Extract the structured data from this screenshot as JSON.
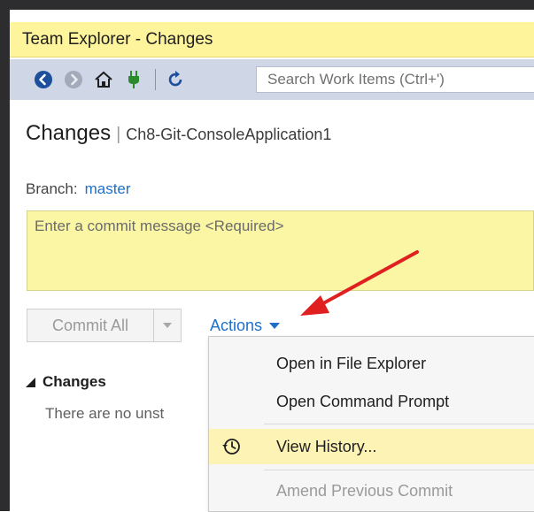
{
  "window": {
    "title": "Team Explorer - Changes"
  },
  "toolbar": {
    "search_placeholder": "Search Work Items (Ctrl+')",
    "icons": [
      "back-icon",
      "forward-icon",
      "home-icon",
      "connect-icon",
      "refresh-icon"
    ]
  },
  "header": {
    "title": "Changes",
    "separator": "|",
    "repository": "Ch8-Git-ConsoleApplication1"
  },
  "branch": {
    "label": "Branch:",
    "name": "master"
  },
  "commit": {
    "message_placeholder": "Enter a commit message <Required>",
    "commit_all_label": "Commit All"
  },
  "actions": {
    "label": "Actions"
  },
  "changes_section": {
    "title": "Changes",
    "empty_text": "There are no unst"
  },
  "menu": {
    "items": [
      {
        "label": "Open in File Explorer",
        "state": "normal"
      },
      {
        "label": "Open Command Prompt",
        "state": "normal"
      },
      {
        "label": "View History...",
        "state": "highlighted",
        "icon": "history-icon"
      },
      {
        "label": "Amend Previous Commit",
        "state": "disabled"
      }
    ]
  },
  "colors": {
    "title_bar": "#fef49c",
    "toolbar": "#cfd6e5",
    "commit_box": "#fbf6a4",
    "link": "#1e6fc8",
    "highlight": "#fdf3b5",
    "annotation_arrow": "#e02020"
  }
}
